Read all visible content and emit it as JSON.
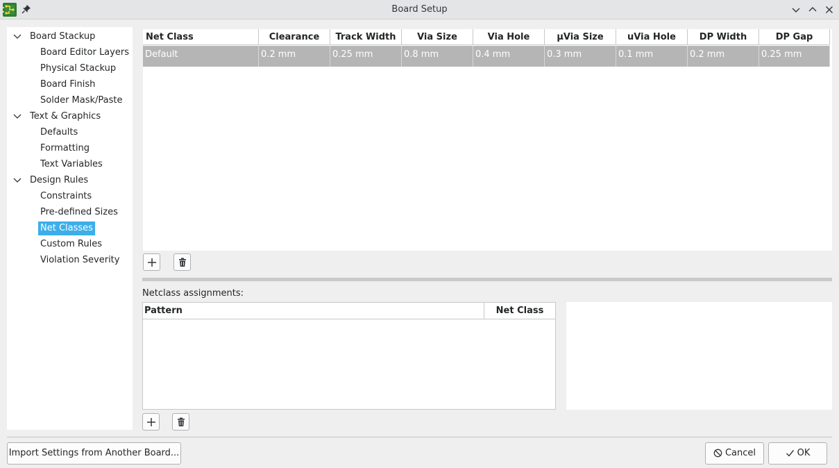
{
  "window": {
    "title": "Board Setup"
  },
  "sidebar": {
    "items": [
      {
        "label": "Board Stackup",
        "level": 0,
        "expanded": true
      },
      {
        "label": "Board Editor Layers",
        "level": 1
      },
      {
        "label": "Physical Stackup",
        "level": 1
      },
      {
        "label": "Board Finish",
        "level": 1
      },
      {
        "label": "Solder Mask/Paste",
        "level": 1
      },
      {
        "label": "Text & Graphics",
        "level": 0,
        "expanded": true
      },
      {
        "label": "Defaults",
        "level": 1
      },
      {
        "label": "Formatting",
        "level": 1
      },
      {
        "label": "Text Variables",
        "level": 1
      },
      {
        "label": "Design Rules",
        "level": 0,
        "expanded": true
      },
      {
        "label": "Constraints",
        "level": 1
      },
      {
        "label": "Pre-defined Sizes",
        "level": 1
      },
      {
        "label": "Net Classes",
        "level": 1,
        "selected": true
      },
      {
        "label": "Custom Rules",
        "level": 1
      },
      {
        "label": "Violation Severity",
        "level": 1
      }
    ]
  },
  "netclass_grid": {
    "columns": [
      "Net Class",
      "Clearance",
      "Track Width",
      "Via Size",
      "Via Hole",
      "µVia Size",
      "uVia Hole",
      "DP Width",
      "DP Gap"
    ],
    "rows": [
      [
        "Default",
        "0.2 mm",
        "0.25 mm",
        "0.8 mm",
        "0.4 mm",
        "0.3 mm",
        "0.1 mm",
        "0.2 mm",
        "0.25 mm"
      ]
    ]
  },
  "assignments": {
    "label": "Netclass assignments:",
    "columns": [
      "Pattern",
      "Net Class"
    ]
  },
  "buttons": {
    "import": "Import Settings from Another Board...",
    "cancel": "Cancel",
    "ok": "OK"
  },
  "colors": {
    "selection": "#3daee9",
    "selected_row": "#b5b5b5"
  }
}
